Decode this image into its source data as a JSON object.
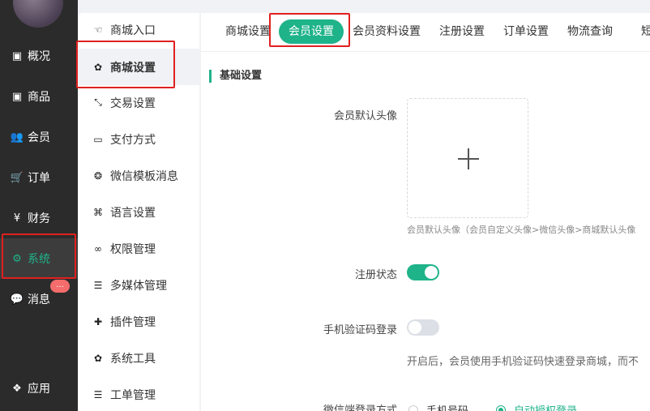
{
  "rail": {
    "items": [
      {
        "label": "概况",
        "icon": "home-icon",
        "glyph": "▣"
      },
      {
        "label": "商品",
        "icon": "goods-icon",
        "glyph": "▣"
      },
      {
        "label": "会员",
        "icon": "users-icon",
        "glyph": "👥"
      },
      {
        "label": "订单",
        "icon": "cart-icon",
        "glyph": "🛒"
      },
      {
        "label": "财务",
        "icon": "yen-icon",
        "glyph": "¥"
      },
      {
        "label": "系统",
        "icon": "gears-icon",
        "glyph": "⚙"
      },
      {
        "label": "消息",
        "icon": "chat-icon",
        "glyph": "💬"
      },
      {
        "label": "应用",
        "icon": "apps-icon",
        "glyph": "❖"
      }
    ],
    "badge": "...",
    "active_color": "#1fb38a"
  },
  "submenu": {
    "items": [
      {
        "label": "商城入口",
        "icon": "hand-point-icon",
        "glyph": "☜"
      },
      {
        "label": "商城设置",
        "icon": "gear-icon",
        "glyph": "✿"
      },
      {
        "label": "交易设置",
        "icon": "exchange-icon",
        "glyph": "⤡"
      },
      {
        "label": "支付方式",
        "icon": "credit-card-icon",
        "glyph": "▭"
      },
      {
        "label": "微信模板消息",
        "icon": "wechat-icon",
        "glyph": "❂"
      },
      {
        "label": "语言设置",
        "icon": "translate-icon",
        "glyph": "⌘"
      },
      {
        "label": "权限管理",
        "icon": "mask-icon",
        "glyph": "∞"
      },
      {
        "label": "多媒体管理",
        "icon": "list-icon",
        "glyph": "☰"
      },
      {
        "label": "插件管理",
        "icon": "puzzle-icon",
        "glyph": "✚"
      },
      {
        "label": "系统工具",
        "icon": "tool-gear-icon",
        "glyph": "✿"
      },
      {
        "label": "工单管理",
        "icon": "ticket-list-icon",
        "glyph": "☰"
      }
    ]
  },
  "tabs": [
    "商城设置",
    "会员设置",
    "会员资料设置",
    "注册设置",
    "订单设置",
    "物流查询",
    "短"
  ],
  "form": {
    "section_title": "基础设置",
    "avatar_label": "会员默认头像",
    "avatar_hint": "会员默认头像（会员自定义头像>微信头像>商城默认头像",
    "register_label": "注册状态",
    "register_on": true,
    "sms_label": "手机验证码登录",
    "sms_on": false,
    "sms_hint": "开启后，会员使用手机验证码快速登录商城，而不",
    "wechat_label": "微信端登录方式",
    "wechat_options": [
      "手机号码",
      "自动授权登录"
    ],
    "wechat_selected": 1
  },
  "accent_color": "#1fb38a",
  "annotation_color": "#e02020"
}
